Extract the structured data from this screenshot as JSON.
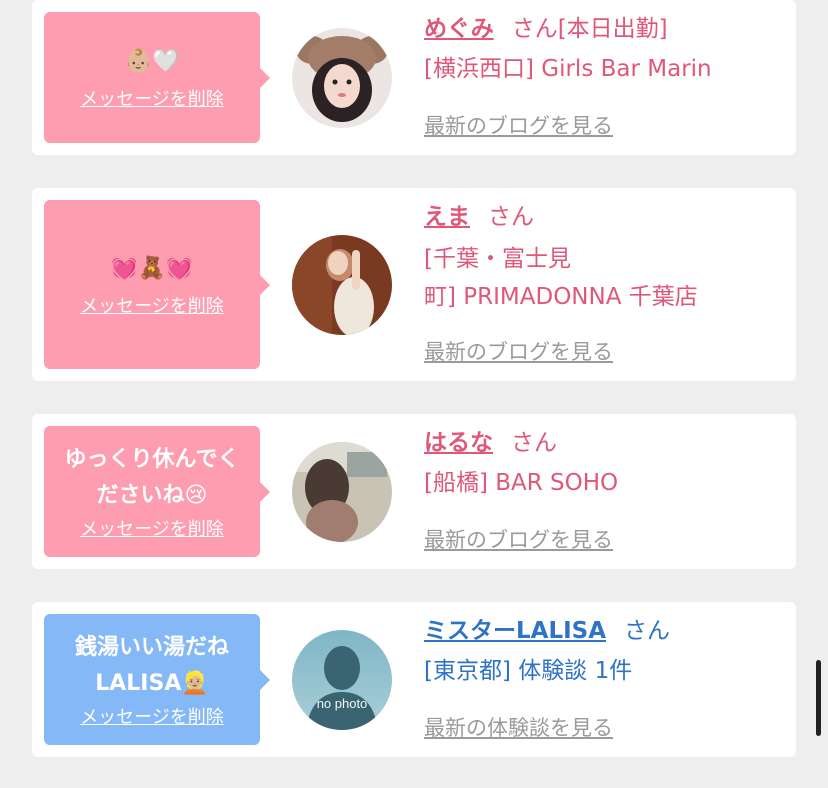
{
  "messages": [
    {
      "message_emoji": "👶🏼🤍",
      "delete_label": "メッセージを削除",
      "name": "めぐみ",
      "suffix": "さん[本日出勤]",
      "shop": "[横浜西口] Girls Bar Marin",
      "link": "最新のブログを見る"
    },
    {
      "message_emoji": "💓🧸💓",
      "delete_label": "メッセージを削除",
      "name": "えま",
      "suffix": "さん",
      "shop_line1": "[千葉・富士見",
      "shop_line2": "町] PRIMADONNA 千葉店",
      "link": "最新のブログを見る"
    },
    {
      "message_line1": "ゆっくり休んでく",
      "message_line2": "ださいね😢",
      "delete_label": "メッセージを削除",
      "name": "はるな",
      "suffix": "さん",
      "shop": "[船橋] BAR SOHO",
      "link": "最新のブログを見る"
    },
    {
      "message_line1": "銭湯いい湯だね",
      "message_line2": "LALISA👱🏼",
      "delete_label": "メッセージを削除",
      "name": "ミスターLALISA",
      "suffix": "さん",
      "shop": "[東京都] 体験談 1件",
      "link": "最新の体験談を見る",
      "avatar_text": "no photo"
    }
  ],
  "colors": {
    "pink_bubble": "#fe9db0",
    "blue_bubble": "#84b8f7",
    "pink_text": "#e0577a",
    "blue_text": "#2e73c8",
    "link_gray": "#9a9a9a"
  }
}
